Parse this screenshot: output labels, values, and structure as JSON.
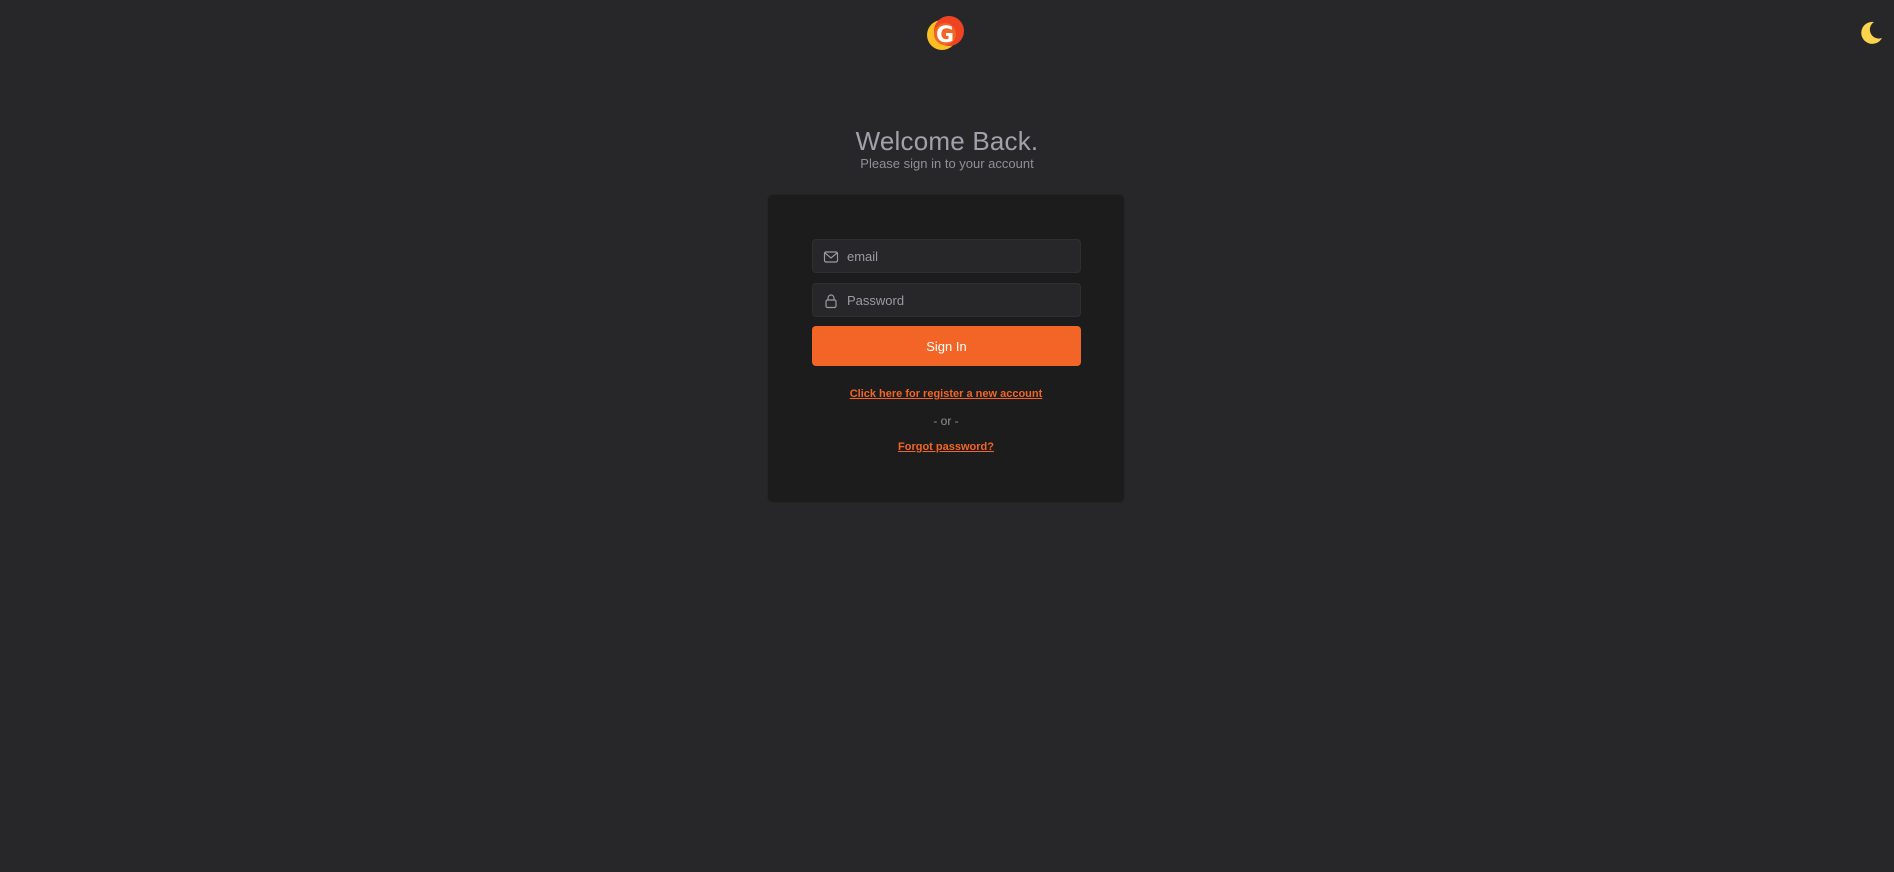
{
  "header": {
    "logo_icon": "brand-g-logo-icon",
    "theme_toggle_icon": "moon-icon",
    "colors": {
      "background": "#27272a",
      "accent": "#f26526",
      "moon": "#fcd34d"
    }
  },
  "welcome": {
    "title": "Welcome Back.",
    "subtitle": "Please sign in to your account"
  },
  "form": {
    "email": {
      "icon": "mail-icon",
      "placeholder": "email",
      "value": ""
    },
    "password": {
      "icon": "lock-icon",
      "placeholder": "Password",
      "value": ""
    },
    "signin_label": "Sign In",
    "register_link": "Click here for register a new account",
    "or_text": "- or -",
    "forgot_link": "Forgot password?"
  }
}
